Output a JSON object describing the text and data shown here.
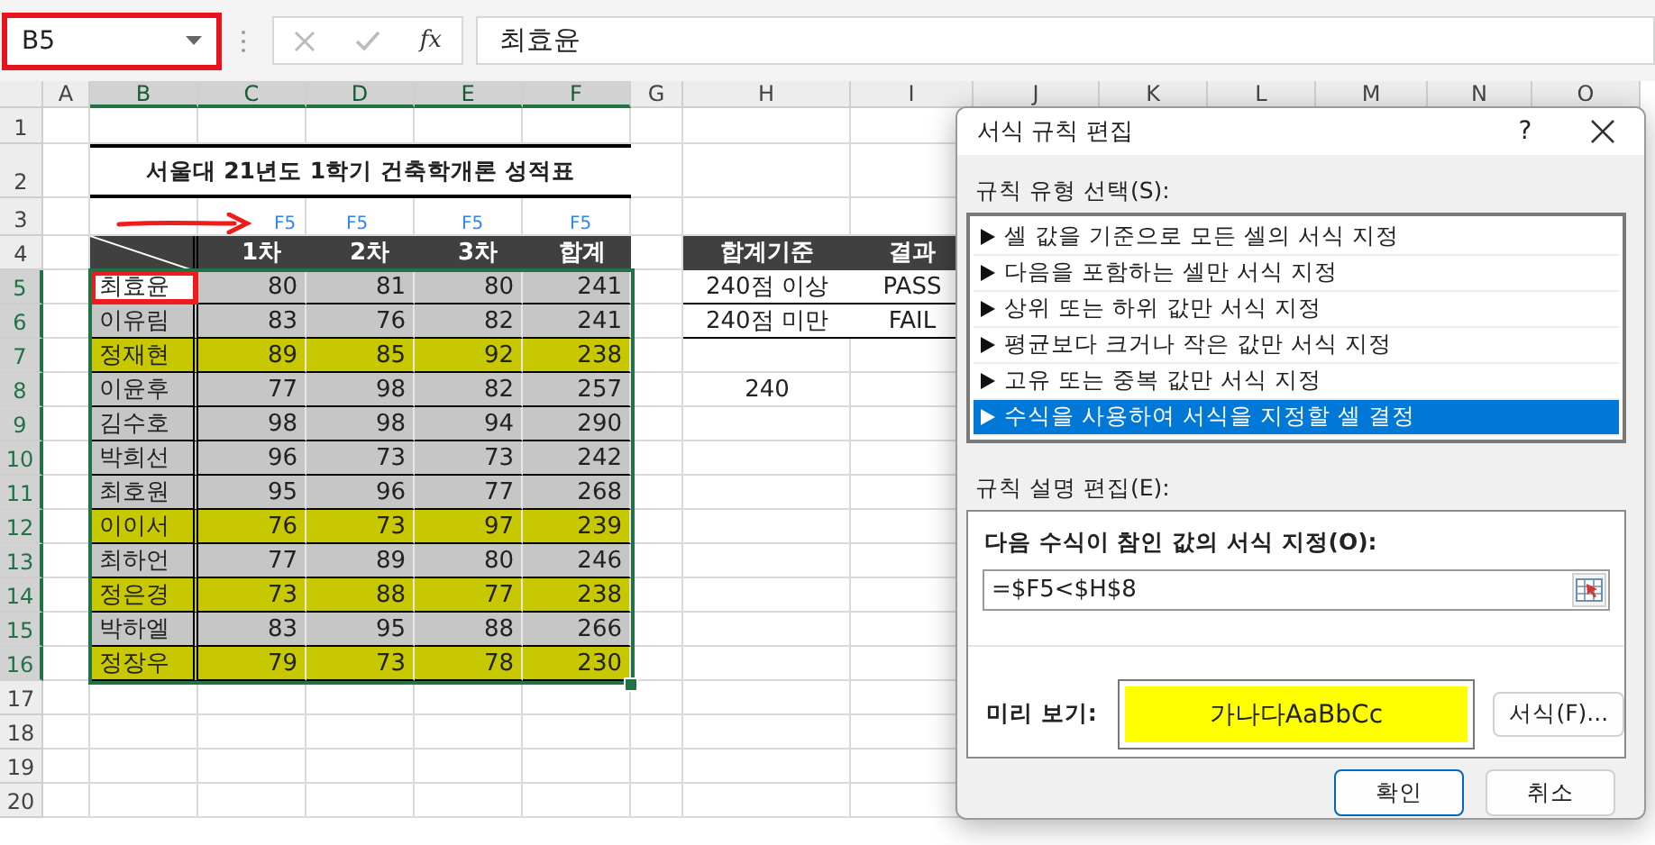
{
  "formula_bar": {
    "name_box": "B5",
    "function_label": "fx",
    "formula": "최효윤"
  },
  "column_headers": [
    "A",
    "B",
    "C",
    "D",
    "E",
    "F",
    "G",
    "H",
    "I",
    "J",
    "K",
    "L",
    "M",
    "N",
    "O"
  ],
  "row_headers": [
    "1",
    "2",
    "3",
    "4",
    "5",
    "6",
    "7",
    "8",
    "9",
    "10",
    "11",
    "12",
    "13",
    "14",
    "15",
    "16",
    "17",
    "18",
    "19",
    "20"
  ],
  "sheet": {
    "title": "서울대 21년도 1학기 건축학개론 성적표",
    "annotation_labels": [
      "F5",
      "F5",
      "F5",
      "F5"
    ],
    "score_table": {
      "columns": [
        "1차",
        "2차",
        "3차",
        "합계"
      ],
      "rows": [
        {
          "name": "최효윤",
          "scores": [
            "80",
            "81",
            "80"
          ],
          "total": "241",
          "highlighted": false,
          "selected": true
        },
        {
          "name": "이유림",
          "scores": [
            "83",
            "76",
            "82"
          ],
          "total": "241",
          "highlighted": false,
          "selected": false
        },
        {
          "name": "정재현",
          "scores": [
            "89",
            "85",
            "92"
          ],
          "total": "238",
          "highlighted": true,
          "selected": false
        },
        {
          "name": "이윤후",
          "scores": [
            "77",
            "98",
            "82"
          ],
          "total": "257",
          "highlighted": false,
          "selected": false
        },
        {
          "name": "김수호",
          "scores": [
            "98",
            "98",
            "94"
          ],
          "total": "290",
          "highlighted": false,
          "selected": false
        },
        {
          "name": "박희선",
          "scores": [
            "96",
            "73",
            "73"
          ],
          "total": "242",
          "highlighted": false,
          "selected": false
        },
        {
          "name": "최호원",
          "scores": [
            "95",
            "96",
            "77"
          ],
          "total": "268",
          "highlighted": false,
          "selected": false
        },
        {
          "name": "이이서",
          "scores": [
            "76",
            "73",
            "97"
          ],
          "total": "239",
          "highlighted": true,
          "selected": false
        },
        {
          "name": "최하언",
          "scores": [
            "77",
            "89",
            "80"
          ],
          "total": "246",
          "highlighted": false,
          "selected": false
        },
        {
          "name": "정은경",
          "scores": [
            "73",
            "88",
            "77"
          ],
          "total": "238",
          "highlighted": true,
          "selected": false
        },
        {
          "name": "박하엘",
          "scores": [
            "83",
            "95",
            "88"
          ],
          "total": "266",
          "highlighted": false,
          "selected": false
        },
        {
          "name": "정장우",
          "scores": [
            "79",
            "73",
            "78"
          ],
          "total": "230",
          "highlighted": true,
          "selected": false
        }
      ]
    },
    "criteria_table": {
      "columns": [
        "합계기준",
        "결과"
      ],
      "rows": [
        {
          "criterion": "240점 이상",
          "result": "PASS"
        },
        {
          "criterion": "240점 미만",
          "result": "FAIL"
        }
      ]
    },
    "threshold": "240"
  },
  "dialog": {
    "title": "서식 규칙 편집",
    "help": "?",
    "rule_type_label": "규칙 유형 선택(S):",
    "rule_types": [
      {
        "label": "셀 값을 기준으로 모든 셀의 서식 지정",
        "selected": false
      },
      {
        "label": "다음을 포함하는 셀만 서식 지정",
        "selected": false
      },
      {
        "label": "상위 또는 하위 값만 서식 지정",
        "selected": false
      },
      {
        "label": "평균보다 크거나 작은 값만 서식 지정",
        "selected": false
      },
      {
        "label": "고유 또는 중복 값만 서식 지정",
        "selected": false
      },
      {
        "label": "수식을 사용하여 서식을 지정할 셀 결정",
        "selected": true
      }
    ],
    "description_label": "규칙 설명 편집(E):",
    "formula_label": "다음 수식이 참인 값의 서식 지정(O):",
    "formula": "=$F5<$H$8",
    "preview_label": "미리 보기:",
    "preview_text": "가나다AaBbCc",
    "format_button": "서식(F)...",
    "ok_button": "확인",
    "cancel_button": "취소"
  }
}
